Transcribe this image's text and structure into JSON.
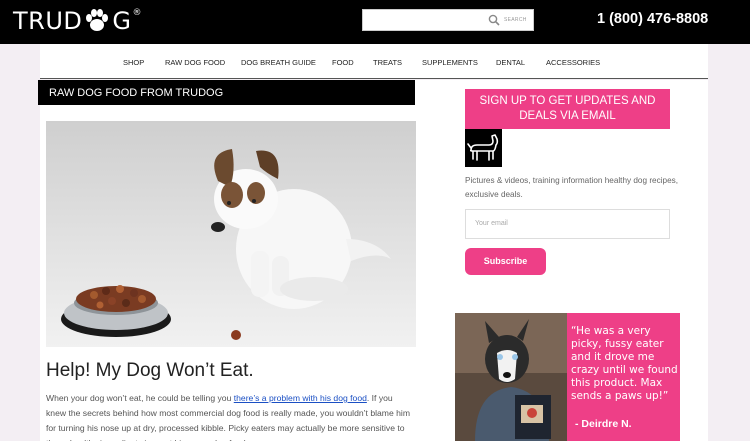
{
  "brand": {
    "name_left": "TRUD",
    "name_right": "G",
    "reg": "®"
  },
  "search": {
    "placeholder": "SEARCH"
  },
  "phone": "1 (800) 476-8808",
  "nav": [
    "SHOP",
    "RAW DOG FOOD",
    "DOG BREATH GUIDE",
    "FOOD",
    "TREATS",
    "SUPPLEMENTS",
    "DENTAL",
    "ACCESSORIES"
  ],
  "page_title": "RAW DOG FOOD FROM TRUDOG",
  "article": {
    "heading": "Help! My Dog Won’t Eat.",
    "p_before": "When your dog won’t eat, he could be telling you ",
    "link": "there’s a problem with his dog food",
    "p_after": ". If you knew the secrets behind how most commercial dog food is really made, you wouldn’t blame him for turning his nose up at dry, processed kibble. Picky eaters may actually be more sensitive to the unhealthy ingredients in most big name dog foods."
  },
  "sidebar": {
    "signup_title": "SIGN UP TO GET UPDATES AND DEALS VIA EMAIL",
    "promo": "Pictures & videos, training information healthy dog recipes, exclusive deals.",
    "email_placeholder": "Your email",
    "subscribe_label": "Subscribe"
  },
  "testimonial": {
    "quote": "“He was a very picky, fussy eater and it drove me crazy until we found this product. Max sends a paws up!”",
    "author": "- Deirdre N."
  },
  "colors": {
    "accent": "#ee3f87",
    "topbar": "#000000",
    "link": "#1a4fc4"
  }
}
